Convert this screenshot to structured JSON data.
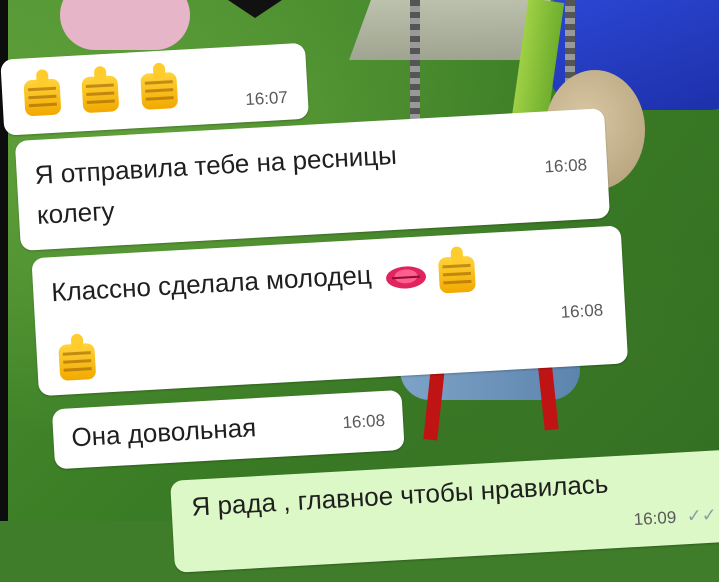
{
  "messages": [
    {
      "id": "m1",
      "direction": "incoming",
      "emoji": [
        "thumbs-up",
        "thumbs-up",
        "thumbs-up"
      ],
      "time": "16:07"
    },
    {
      "id": "m2",
      "direction": "incoming",
      "text_line1": "Я отправила тебе на ресницы",
      "text_line2": "колегу",
      "time": "16:08"
    },
    {
      "id": "m3",
      "direction": "incoming",
      "text": "Классно сделала молодец",
      "emoji_inline": [
        "kiss-lips",
        "thumbs-up"
      ],
      "emoji_next_line": [
        "thumbs-up"
      ],
      "time": "16:08"
    },
    {
      "id": "m4",
      "direction": "incoming",
      "text": "Она довольная",
      "time": "16:08"
    },
    {
      "id": "m5",
      "direction": "outgoing",
      "text": "Я рада , главное чтобы нравилась",
      "time": "16:09",
      "status": "read-double-check"
    }
  ],
  "icons": {
    "read_receipt": "✓✓"
  },
  "colors": {
    "incoming_bubble": "#ffffff",
    "outgoing_bubble": "#dcf8c6",
    "time_text": "#5a5a5a"
  }
}
